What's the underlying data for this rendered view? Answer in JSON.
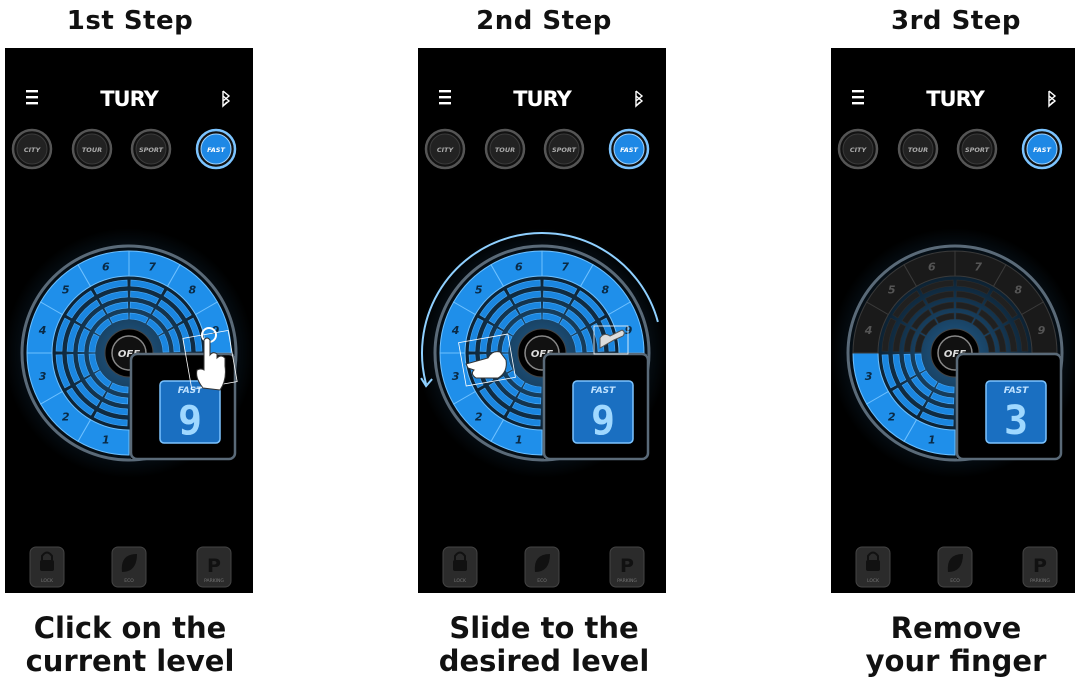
{
  "steps": [
    {
      "title": "1st Step",
      "caption_line1": "Click on the",
      "caption_line2": "current level",
      "display_mode": "FAST",
      "display_value": "9",
      "active_level": 9,
      "gesture": "tap"
    },
    {
      "title": "2nd Step",
      "caption_line1": "Slide to the",
      "caption_line2": "desired level",
      "display_mode": "FAST",
      "display_value": "9",
      "active_level": 9,
      "gesture": "slide"
    },
    {
      "title": "3rd Step",
      "caption_line1": "Remove",
      "caption_line2": "your finger",
      "display_mode": "FAST",
      "display_value": "3",
      "active_level": 3,
      "gesture": "none"
    }
  ],
  "app": {
    "brand": "TURY",
    "menu_icon": "hamburger-menu-icon",
    "bluetooth_icon": "bluetooth-icon",
    "modes": [
      "CITY",
      "TOUR",
      "SPORT",
      "FAST"
    ],
    "active_mode": "FAST",
    "center_button": "OFF",
    "bottom_buttons": [
      {
        "label": "LOCK",
        "icon": "lock-icon"
      },
      {
        "label": "ECO",
        "icon": "leaf-icon"
      },
      {
        "label": "PARKING",
        "icon": "parking-icon",
        "glyph": "P"
      }
    ],
    "levels": [
      "1",
      "2",
      "3",
      "4",
      "5",
      "6",
      "7",
      "8",
      "9"
    ]
  },
  "colors": {
    "accent": "#1e88e5",
    "glow": "#3fa9ff",
    "inactive": "#2a2a2a",
    "background": "#000000",
    "page": "#ffffff"
  }
}
